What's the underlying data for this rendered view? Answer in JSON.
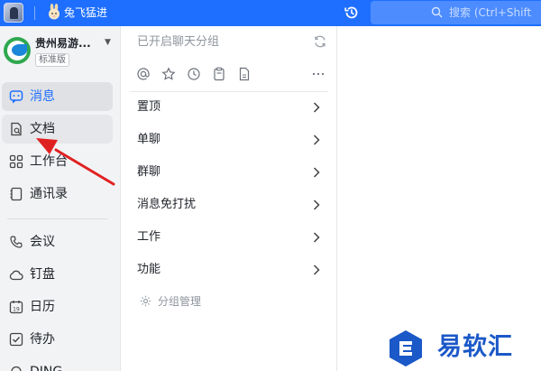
{
  "topbar": {
    "tab_title": "兔飞猛进",
    "search_placeholder": "搜索 (Ctrl+Shift",
    "accent_color": "#1e6fff"
  },
  "org": {
    "name": "贵州易游...",
    "badge": "标准版"
  },
  "sidebar": {
    "items": [
      {
        "label": "消息",
        "icon": "message-icon",
        "state": "active"
      },
      {
        "label": "文档",
        "icon": "document-icon",
        "state": "hover"
      },
      {
        "label": "工作台",
        "icon": "grid-icon",
        "state": ""
      },
      {
        "label": "通讯录",
        "icon": "contacts-icon",
        "state": ""
      },
      {
        "label": "会议",
        "icon": "phone-icon",
        "state": ""
      },
      {
        "label": "钉盘",
        "icon": "cloud-drive-icon",
        "state": ""
      },
      {
        "label": "日历",
        "icon": "calendar-icon",
        "state": ""
      },
      {
        "label": "待办",
        "icon": "todo-icon",
        "state": ""
      },
      {
        "label": "DING",
        "icon": "ding-icon",
        "state": ""
      }
    ]
  },
  "panel": {
    "header": "已开启聊天分组",
    "filters": [
      "at-icon",
      "star-icon",
      "clock-icon",
      "clipboard-icon",
      "file-icon",
      "more-icon"
    ],
    "groups": [
      {
        "label": "置顶"
      },
      {
        "label": "单聊"
      },
      {
        "label": "群聊"
      },
      {
        "label": "消息免打扰"
      },
      {
        "label": "工作"
      },
      {
        "label": "功能"
      }
    ],
    "manage_label": "分组管理"
  },
  "watermark": {
    "text": "易软汇"
  }
}
